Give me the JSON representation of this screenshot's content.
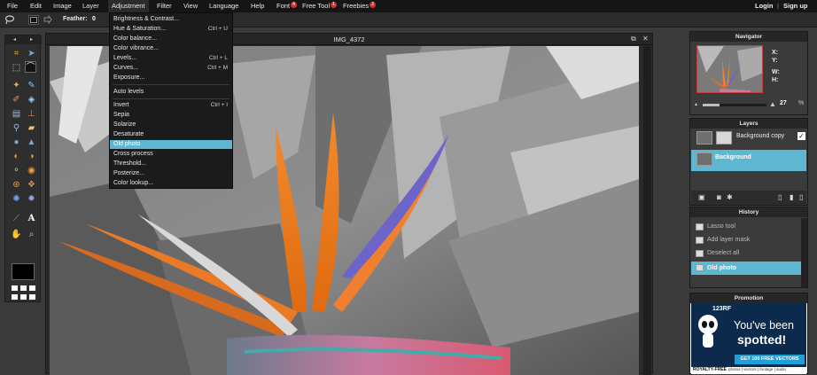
{
  "menubar": {
    "items": [
      {
        "label": "File"
      },
      {
        "label": "Edit"
      },
      {
        "label": "Image"
      },
      {
        "label": "Layer"
      },
      {
        "label": "Adjustment"
      },
      {
        "label": "Filter"
      },
      {
        "label": "View"
      },
      {
        "label": "Language"
      },
      {
        "label": "Help"
      },
      {
        "label": "Font",
        "badge": "4"
      },
      {
        "label": "Free Tool",
        "badge": "1"
      },
      {
        "label": "Freebies",
        "badge": "2"
      }
    ],
    "login": "Login",
    "separator": "|",
    "signup": "Sign up"
  },
  "options": {
    "feather_label": "Feather:",
    "feather_value": "0"
  },
  "document": {
    "title": "IMG_4372",
    "restore_icon": "restore-icon",
    "close_icon": "close-icon"
  },
  "adjustment_menu": {
    "items": [
      {
        "label": "Brightness & Contrast...",
        "shortcut": ""
      },
      {
        "label": "Hue & Saturation...",
        "shortcut": "Ctrl + U"
      },
      {
        "label": "Color balance...",
        "shortcut": ""
      },
      {
        "label": "Color vibrance...",
        "shortcut": ""
      },
      {
        "label": "Levels...",
        "shortcut": "Ctrl + L"
      },
      {
        "label": "Curves...",
        "shortcut": "Ctrl + M"
      },
      {
        "label": "Exposure...",
        "shortcut": ""
      },
      {
        "label": "Auto levels",
        "shortcut": ""
      },
      {
        "label": "Invert",
        "shortcut": "Ctrl + I"
      },
      {
        "label": "Sepia",
        "shortcut": ""
      },
      {
        "label": "Solarize",
        "shortcut": ""
      },
      {
        "label": "Desaturate",
        "shortcut": ""
      },
      {
        "label": "Old photo",
        "shortcut": "",
        "highlighted": true
      },
      {
        "label": "Cross process",
        "shortcut": ""
      },
      {
        "label": "Threshold...",
        "shortcut": ""
      },
      {
        "label": "Posterize...",
        "shortcut": ""
      },
      {
        "label": "Color lookup...",
        "shortcut": ""
      }
    ]
  },
  "navigator": {
    "title": "Navigator",
    "x_label": "X:",
    "y_label": "Y:",
    "w_label": "W:",
    "h_label": "H:",
    "zoom_value": "27",
    "zoom_unit": "%",
    "zoom_fraction": 0.27
  },
  "layers": {
    "title": "Layers",
    "items": [
      {
        "name": "Background copy",
        "checked": true
      },
      {
        "name": "Background",
        "selected": true
      }
    ]
  },
  "history": {
    "title": "History",
    "items": [
      {
        "label": "Lasso tool"
      },
      {
        "label": "Add layer mask"
      },
      {
        "label": "Deselect all"
      },
      {
        "label": "Old photo",
        "selected": true
      }
    ]
  },
  "promotion": {
    "title": "Promotion",
    "brand": "123RF",
    "headline_1": "You've been",
    "headline_2": "spotted!",
    "cta": "GET 100 FREE VECTORS",
    "footer_1": "ROYALTY-FREE",
    "footer_2": "photos | vectors | footage | audio"
  },
  "colors": {
    "accent": "#5fb6d1",
    "menubar_bg": "#151515",
    "badge": "#d6312b",
    "panel_bg": "#3b3b3b"
  }
}
